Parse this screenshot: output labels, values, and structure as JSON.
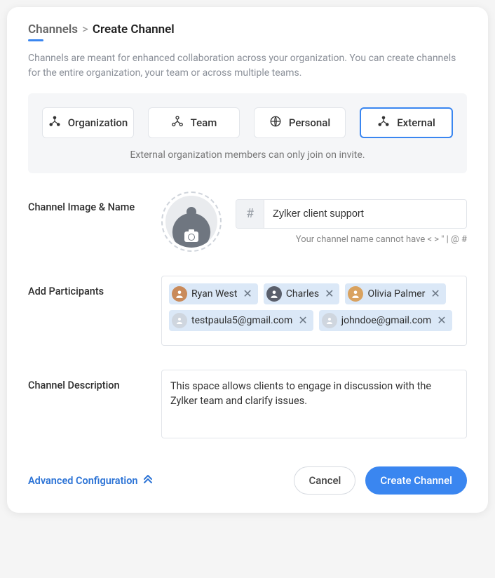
{
  "breadcrumb": {
    "parent": "Channels",
    "separator": ">",
    "current": "Create Channel"
  },
  "intro": "Channels are meant for enhanced collaboration across your organization. You can create channels for the entire organization, your team or across multiple teams.",
  "types": {
    "options": [
      "Organization",
      "Team",
      "Personal",
      "External"
    ],
    "selected": "External",
    "note": "External organization members can only join on invite."
  },
  "labels": {
    "image_name": "Channel Image & Name",
    "participants": "Add Participants",
    "description": "Channel Description",
    "advanced": "Advanced Configuration"
  },
  "channel_name": {
    "prefix": "#",
    "value": "Zylker client support",
    "helper": "Your channel name cannot have < > \" | @ #"
  },
  "participants": [
    {
      "name": "Ryan West",
      "has_avatar": true
    },
    {
      "name": "Charles",
      "has_avatar": true
    },
    {
      "name": "Olivia Palmer",
      "has_avatar": true
    },
    {
      "name": "testpaula5@gmail.com",
      "has_avatar": false
    },
    {
      "name": "johndoe@gmail.com",
      "has_avatar": false
    }
  ],
  "description_value": "This space allows clients to engage in discussion with the Zylker team and clarify issues.",
  "buttons": {
    "cancel": "Cancel",
    "create": "Create Channel"
  },
  "colors": {
    "accent": "#3a86f0"
  }
}
